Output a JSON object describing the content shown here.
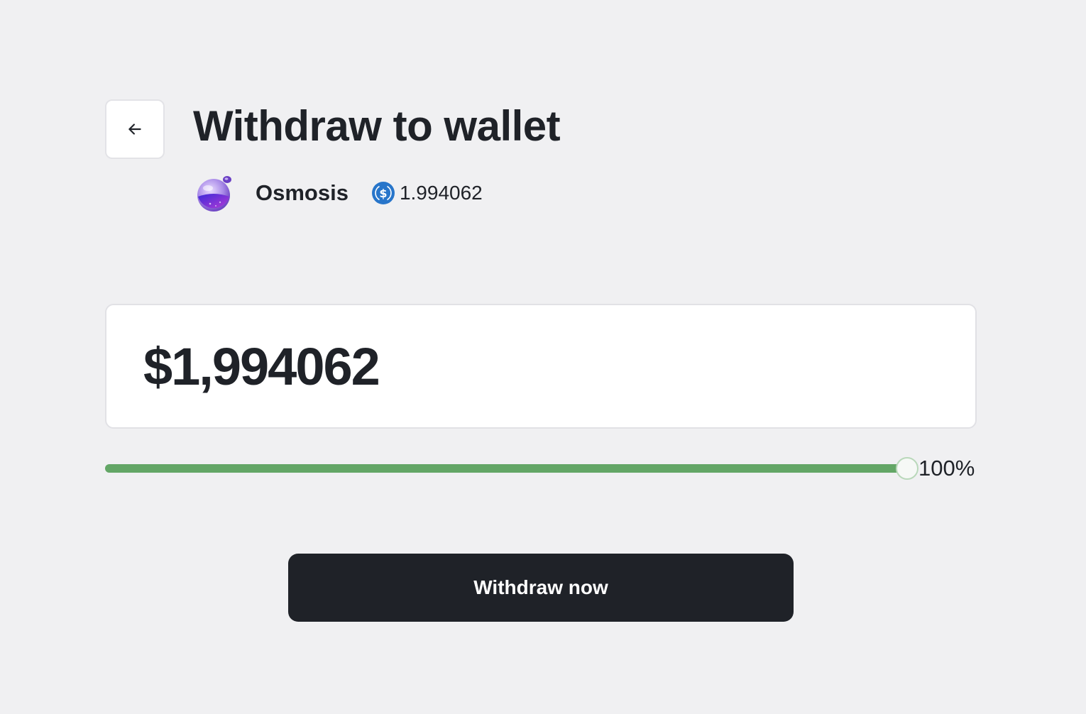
{
  "header": {
    "back_icon": "arrow-left-icon",
    "title": "Withdraw to wallet"
  },
  "network": {
    "logo_icon": "osmosis-logo-icon",
    "name": "Osmosis",
    "token_icon": "usdc-icon",
    "token_balance": "1.994062"
  },
  "amount": {
    "value": "$1,994062"
  },
  "slider": {
    "fraction": 1.0,
    "label": "100%",
    "fill_color": "#63a666"
  },
  "actions": {
    "withdraw_label": "Withdraw now"
  },
  "colors": {
    "background": "#f0f0f2",
    "primary_button": "#1f2228",
    "usdc_blue": "#2775ca"
  }
}
